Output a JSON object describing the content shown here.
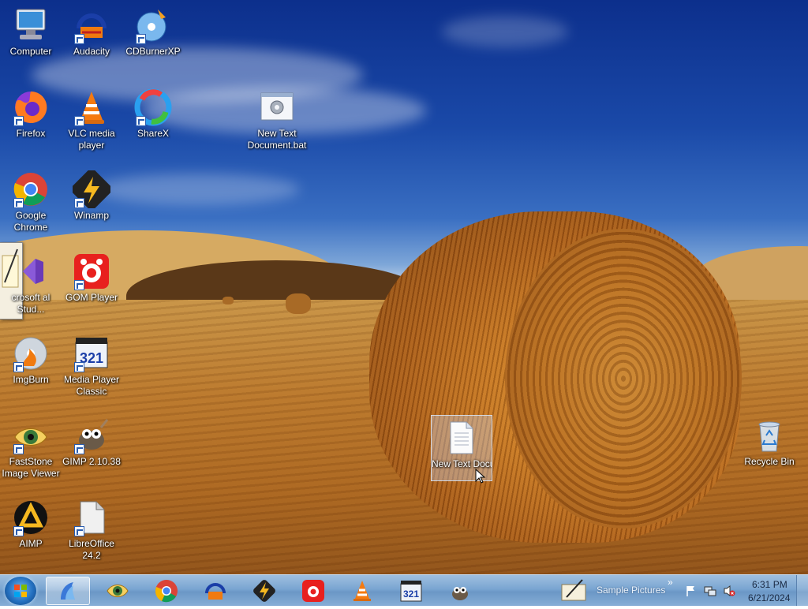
{
  "desktop": {
    "icons": [
      {
        "label": "Computer",
        "icon": "computer-icon"
      },
      {
        "label": "Audacity",
        "icon": "audacity-icon"
      },
      {
        "label": "CDBurnerXP",
        "icon": "cdburnerxp-icon"
      },
      {
        "label": "Firefox",
        "icon": "firefox-icon"
      },
      {
        "label": "VLC media player",
        "icon": "vlc-icon"
      },
      {
        "label": "ShareX",
        "icon": "sharex-icon"
      },
      {
        "label": "New Text Document.bat",
        "icon": "batch-file-icon"
      },
      {
        "label": "Google Chrome",
        "icon": "chrome-icon"
      },
      {
        "label": "Winamp",
        "icon": "winamp-icon"
      },
      {
        "label": "crosoft al Stud...",
        "icon": "visual-studio-icon"
      },
      {
        "label": "GOM Player",
        "icon": "gom-player-icon"
      },
      {
        "label": "ImgBurn",
        "icon": "imgburn-icon"
      },
      {
        "label": "Media Player Classic",
        "icon": "mpc-icon"
      },
      {
        "label": "FastStone Image Viewer",
        "icon": "faststone-icon"
      },
      {
        "label": "GIMP 2.10.38",
        "icon": "gimp-icon"
      },
      {
        "label": "New Text Document.txt",
        "icon": "text-file-icon"
      },
      {
        "label": "Recycle Bin",
        "icon": "recycle-bin-icon"
      },
      {
        "label": "AIMP",
        "icon": "aimp-icon"
      },
      {
        "label": "LibreOffice 24.2",
        "icon": "libreoffice-icon"
      }
    ]
  },
  "taskbar": {
    "start": "start-button",
    "pinned": [
      "explorer-icon",
      "faststone-icon",
      "chrome-icon",
      "audacity-icon",
      "winamp-icon",
      "gom-player-icon",
      "vlc-icon",
      "mpc-icon",
      "gimp-icon"
    ],
    "toolbar_label": "Sample Pictures",
    "chevron": "»",
    "time": "6:31 PM",
    "date": "6/21/2024"
  },
  "colors": {
    "taskbar": "#7aa5d1",
    "sky": "#1a49a8",
    "hay": "#c4741f"
  }
}
